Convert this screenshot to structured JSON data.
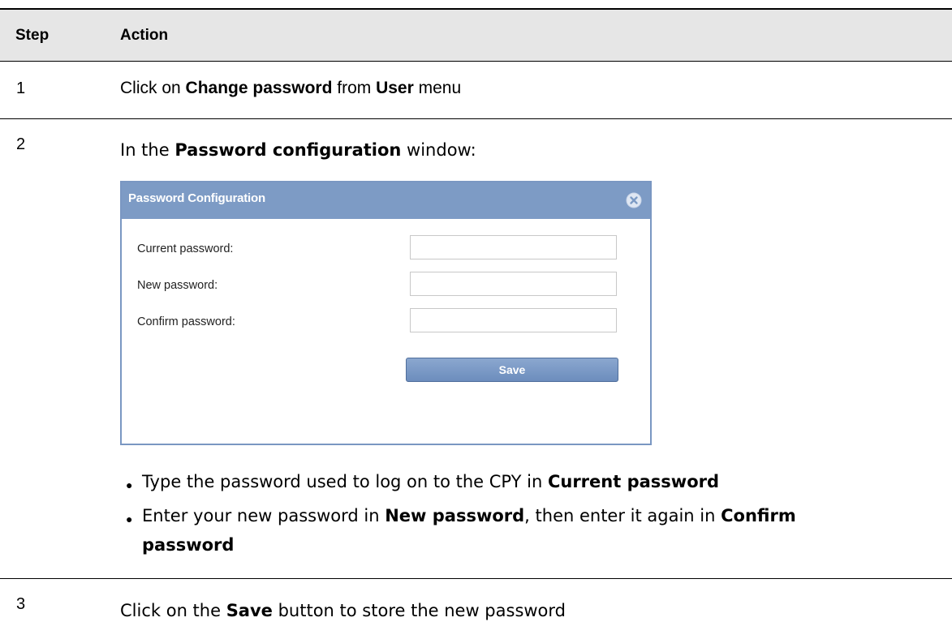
{
  "table": {
    "headers": {
      "step": "Step",
      "action": "Action"
    }
  },
  "rows": [
    {
      "step": "1",
      "text": {
        "p1": "Click on ",
        "b1": "Change password",
        "p2": " from ",
        "b2": "User",
        "p3": " menu"
      }
    },
    {
      "step": "2",
      "intro": {
        "p1": "In the ",
        "b1": "Password configuration",
        "p2": " window:"
      },
      "bullets": [
        {
          "p1": "Type the password used to log on to the CPY in ",
          "b1": "Current password"
        },
        {
          "p1": "Enter your new password in ",
          "b1": "New password",
          "p2": ", then enter it again in ",
          "b2": "Confirm",
          "b3": "password"
        }
      ]
    },
    {
      "step": "3",
      "text": {
        "p1": "Click on the ",
        "b1": "Save",
        "p2": " button to store the new password"
      }
    }
  ],
  "dialog": {
    "title": "Password Configuration",
    "close_icon": "close-circle-icon",
    "fields": [
      {
        "label": "Current password:",
        "value": ""
      },
      {
        "label": "New password:",
        "value": ""
      },
      {
        "label": "Confirm password:",
        "value": ""
      }
    ],
    "save_label": "Save",
    "colors": {
      "title_bar": "#7d9bc5",
      "border": "#7a97c2",
      "button": "#7593c2"
    }
  }
}
